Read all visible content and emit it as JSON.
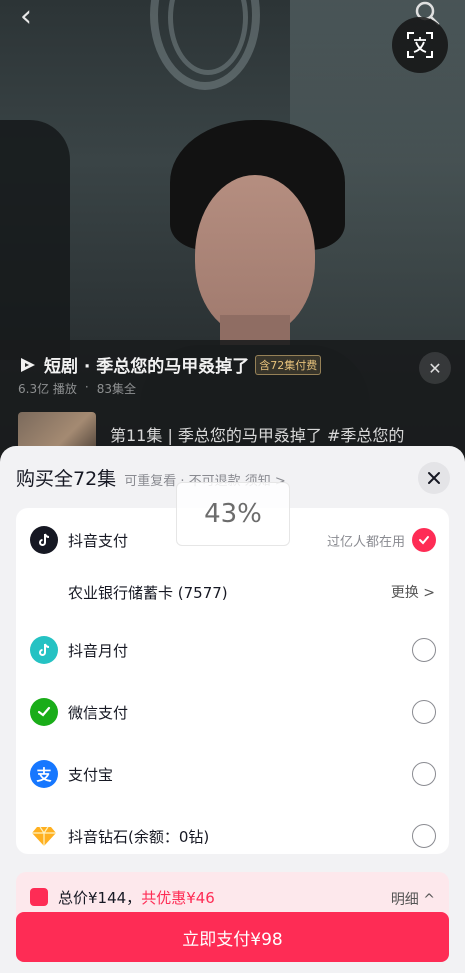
{
  "drama": {
    "title": "短剧 · 季总您的马甲叒掉了",
    "pay_tag": "含72集付费",
    "plays": "6.3亿 播放",
    "episodes_total": "83集全",
    "episode_title": "第11集 | 季总您的马甲叒掉了 #季总您的"
  },
  "sheet": {
    "title": "购买全72集",
    "subtitle": "可重复看 · 不可退款  须知 >",
    "progress": "43%",
    "methods": [
      {
        "icon": "douyin-pay-icon",
        "label": "抖音支付",
        "hint": "过亿人都在用",
        "selected": true
      },
      {
        "icon": "",
        "label": "农业银行储蓄卡 (7577)",
        "change": "更换 >",
        "selected": false
      },
      {
        "icon": "douyin-monthly-pay-icon",
        "label": "抖音月付",
        "selected": false
      },
      {
        "icon": "wechat-pay-icon",
        "label": "微信支付",
        "selected": false
      },
      {
        "icon": "alipay-icon",
        "label": "支付宝",
        "selected": false
      },
      {
        "icon": "diamond-icon",
        "label": "抖音钻石(余额：0钻)",
        "selected": false
      }
    ],
    "total_label": "总价¥144，",
    "discount_label": "共优惠¥46",
    "detail_label": "明细 ^",
    "pay_button": "立即支付¥98"
  },
  "colors": {
    "accent": "#fe2c55",
    "tag_gold": "#e5c17b"
  }
}
